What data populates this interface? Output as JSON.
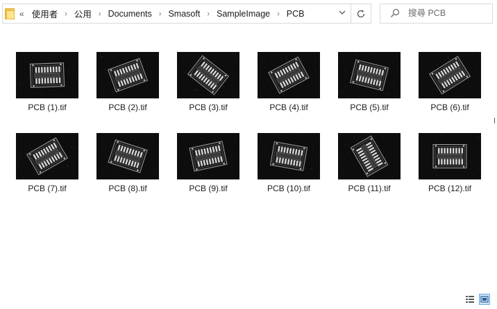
{
  "address_bar": {
    "overflow_label": "«",
    "breadcrumbs": [
      "使用者",
      "公用",
      "Documents",
      "Smasoft",
      "SampleImage",
      "PCB"
    ],
    "separator": "›",
    "dropdown_icon": "chevron-down-icon",
    "refresh_icon": "refresh-icon"
  },
  "search": {
    "placeholder": "搜尋 PCB",
    "icon": "search-icon"
  },
  "files": [
    {
      "name": "PCB (1).tif",
      "rotation": -2
    },
    {
      "name": "PCB (2).tif",
      "rotation": -20
    },
    {
      "name": "PCB (3).tif",
      "rotation": 38
    },
    {
      "name": "PCB (4).tif",
      "rotation": -28
    },
    {
      "name": "PCB (5).tif",
      "rotation": 14
    },
    {
      "name": "PCB (6).tif",
      "rotation": -32
    },
    {
      "name": "PCB (7).tif",
      "rotation": -30
    },
    {
      "name": "PCB (8).tif",
      "rotation": 18
    },
    {
      "name": "PCB (9).tif",
      "rotation": -12
    },
    {
      "name": "PCB (10).tif",
      "rotation": 10
    },
    {
      "name": "PCB (11).tif",
      "rotation": 60
    },
    {
      "name": "PCB (12).tif",
      "rotation": 0
    }
  ],
  "view_buttons": [
    {
      "icon": "details-view-icon",
      "active": false
    },
    {
      "icon": "large-icons-view-icon",
      "active": true
    }
  ],
  "colors": {
    "folder": "#f2c94c",
    "active_view": "#cce4f7",
    "thumb_bg": "#0d0d0d"
  }
}
